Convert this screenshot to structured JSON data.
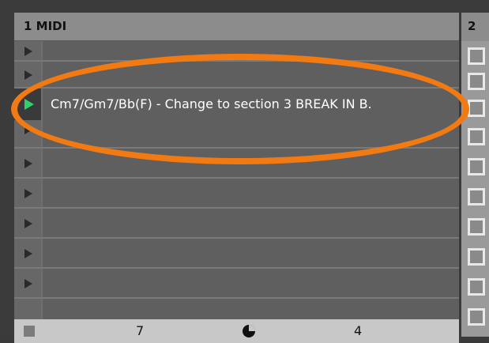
{
  "track1": {
    "title": "1 MIDI",
    "clip": {
      "name": "Cm7/Gm7/Bb(F) - Change to section 3  BREAK IN B.",
      "color": "#2fd16a"
    },
    "footer": {
      "left_value": "7",
      "right_value": "4",
      "stop_icon": "stop-square-icon",
      "pie_icon": "cpu-pie-icon"
    }
  },
  "track2": {
    "title": "2"
  },
  "colors": {
    "annotation": "#f27a12",
    "clip_launch": "#2fd16a"
  }
}
